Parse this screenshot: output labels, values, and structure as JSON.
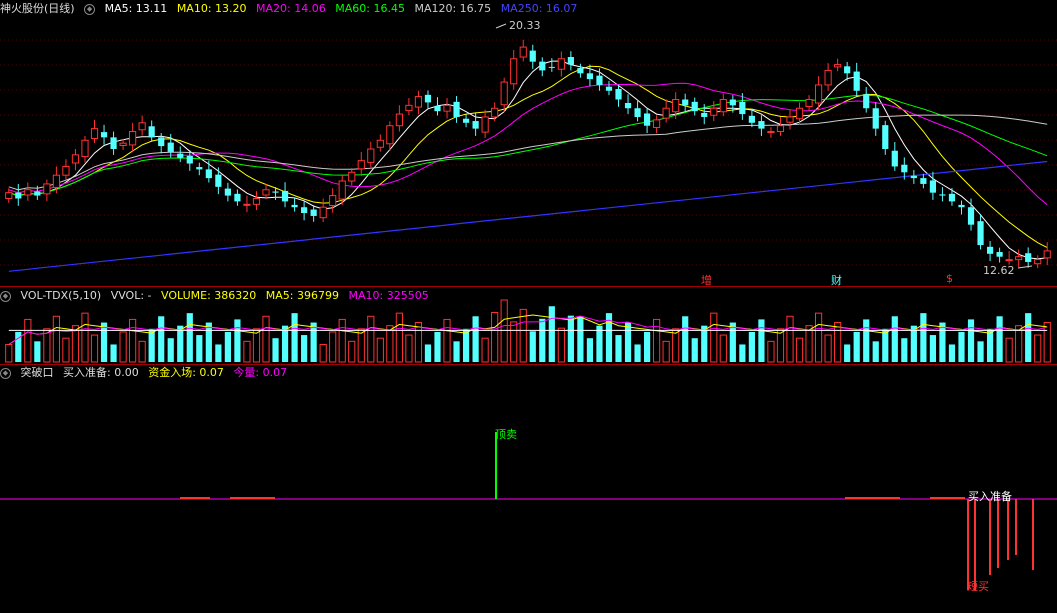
{
  "main_header": {
    "title": "神火股份(日线)",
    "ma5": "MA5: 13.11",
    "ma10": "MA10: 13.20",
    "ma20": "MA20: 14.06",
    "ma60": "MA60: 16.45",
    "ma120": "MA120: 16.75",
    "ma250": "MA250: 16.07"
  },
  "vol_header": {
    "name": "VOL-TDX(5,10)",
    "vvol": "VVOL: -",
    "volume": "VOLUME: 386320",
    "ma5": "MA5: 396799",
    "ma10": "MA10: 325505"
  },
  "ind_header": {
    "name": "突破口",
    "buy_prep": "买入准备: 0.00",
    "fund_entry": "资金入场: 0.07",
    "amount": "今量: 0.07"
  },
  "annotations": {
    "high_label": "20.33",
    "low_label": "12.62",
    "marker_zeng": "增",
    "marker_cai": "财",
    "marker_s": "$",
    "top_sell": "顶卖",
    "buy_prep_label": "买入准备",
    "short_buy": "短买"
  },
  "colors": {
    "up": "#ff3232",
    "down": "#54ffff",
    "ma5": "#ffffff",
    "ma10": "#ffff00",
    "ma20": "#ff00ff",
    "ma60": "#00ff00",
    "ma120": "#cccccc",
    "ma250": "#3333ff"
  },
  "chart_data": {
    "type": "candlestick",
    "symbol": "神火股份",
    "period": "日线",
    "ylim": [
      12.0,
      21.0
    ],
    "close": [
      15.0,
      14.8,
      15.1,
      14.9,
      15.3,
      15.6,
      15.9,
      16.3,
      16.8,
      17.2,
      16.9,
      16.5,
      16.7,
      17.1,
      17.4,
      16.9,
      16.6,
      16.4,
      16.2,
      16.0,
      15.8,
      15.5,
      15.2,
      14.9,
      14.7,
      14.6,
      14.8,
      15.1,
      15.0,
      14.7,
      14.5,
      14.3,
      14.2,
      14.5,
      14.9,
      15.4,
      15.7,
      16.1,
      16.5,
      16.8,
      17.3,
      17.7,
      18.0,
      18.3,
      18.1,
      17.8,
      18.0,
      17.6,
      17.4,
      17.2,
      17.6,
      17.9,
      18.8,
      19.6,
      20.0,
      19.5,
      19.2,
      19.3,
      19.6,
      19.4,
      19.1,
      18.9,
      18.7,
      18.5,
      18.2,
      17.9,
      17.6,
      17.3,
      17.5,
      17.9,
      18.2,
      18.0,
      17.8,
      17.6,
      17.9,
      18.2,
      18.0,
      17.7,
      17.4,
      17.2,
      17.1,
      17.3,
      17.6,
      17.9,
      18.2,
      18.7,
      19.2,
      19.4,
      19.1,
      18.5,
      17.9,
      17.2,
      16.5,
      15.9,
      15.7,
      15.5,
      15.3,
      15.0,
      14.9,
      14.7,
      14.5,
      13.9,
      13.2,
      12.9,
      12.8,
      12.7,
      12.8,
      12.62,
      12.7,
      13.0
    ],
    "high_mark": 20.33,
    "low_mark": 12.62,
    "ma5_last": 13.11,
    "ma10_last": 13.2,
    "ma20_last": 14.06,
    "ma60_last": 16.45,
    "ma120_last": 16.75,
    "ma250_last": 16.07,
    "volume_last": 386320,
    "vol_ma5_last": 396799,
    "vol_ma10_last": 325505
  }
}
